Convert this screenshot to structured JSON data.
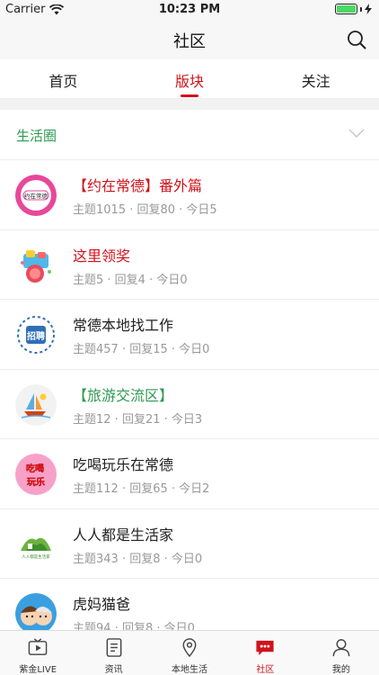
{
  "status_bar": {
    "carrier": "Carrier",
    "time": "10:23 PM"
  },
  "nav": {
    "title": "社区"
  },
  "tabs": [
    {
      "label": "首页"
    },
    {
      "label": "版块"
    },
    {
      "label": "关注"
    }
  ],
  "active_tab": "版块",
  "section": {
    "title": "生活圈"
  },
  "forums": [
    {
      "name": "【约在常德】番外篇",
      "stats": "主题1015 · 回复80 · 今日5",
      "name_color": "red"
    },
    {
      "name": "这里领奖",
      "stats": "主题5 · 回复4 · 今日0",
      "name_color": "red"
    },
    {
      "name": "常德本地找工作",
      "stats": "主题457 · 回复15 · 今日0",
      "name_color": "default"
    },
    {
      "name": "【旅游交流区】",
      "stats": "主题12 · 回复21 · 今日3",
      "name_color": "green"
    },
    {
      "name": "吃喝玩乐在常德",
      "stats": "主题112 · 回复65 · 今日2",
      "name_color": "default"
    },
    {
      "name": "人人都是生活家",
      "stats": "主题343 · 回复8 · 今日0",
      "name_color": "default"
    },
    {
      "name": "虎妈猫爸",
      "stats": "主题94 · 回复8 · 今日0",
      "name_color": "default"
    }
  ],
  "avatar_texts": {
    "yue": "约在常德",
    "zhao": "招聘",
    "chihe": "吃喝",
    "wan": "玩乐",
    "renren": "人人都是生活家"
  },
  "bottom_nav": [
    {
      "label": "紫金LIVE",
      "icon": "tv-icon"
    },
    {
      "label": "资讯",
      "icon": "news-icon"
    },
    {
      "label": "本地生活",
      "icon": "location-icon"
    },
    {
      "label": "社区",
      "icon": "community-icon"
    },
    {
      "label": "我的",
      "icon": "profile-icon"
    }
  ],
  "colors": {
    "accent": "#d0121b",
    "green": "#2e9a52",
    "muted": "#999999"
  }
}
